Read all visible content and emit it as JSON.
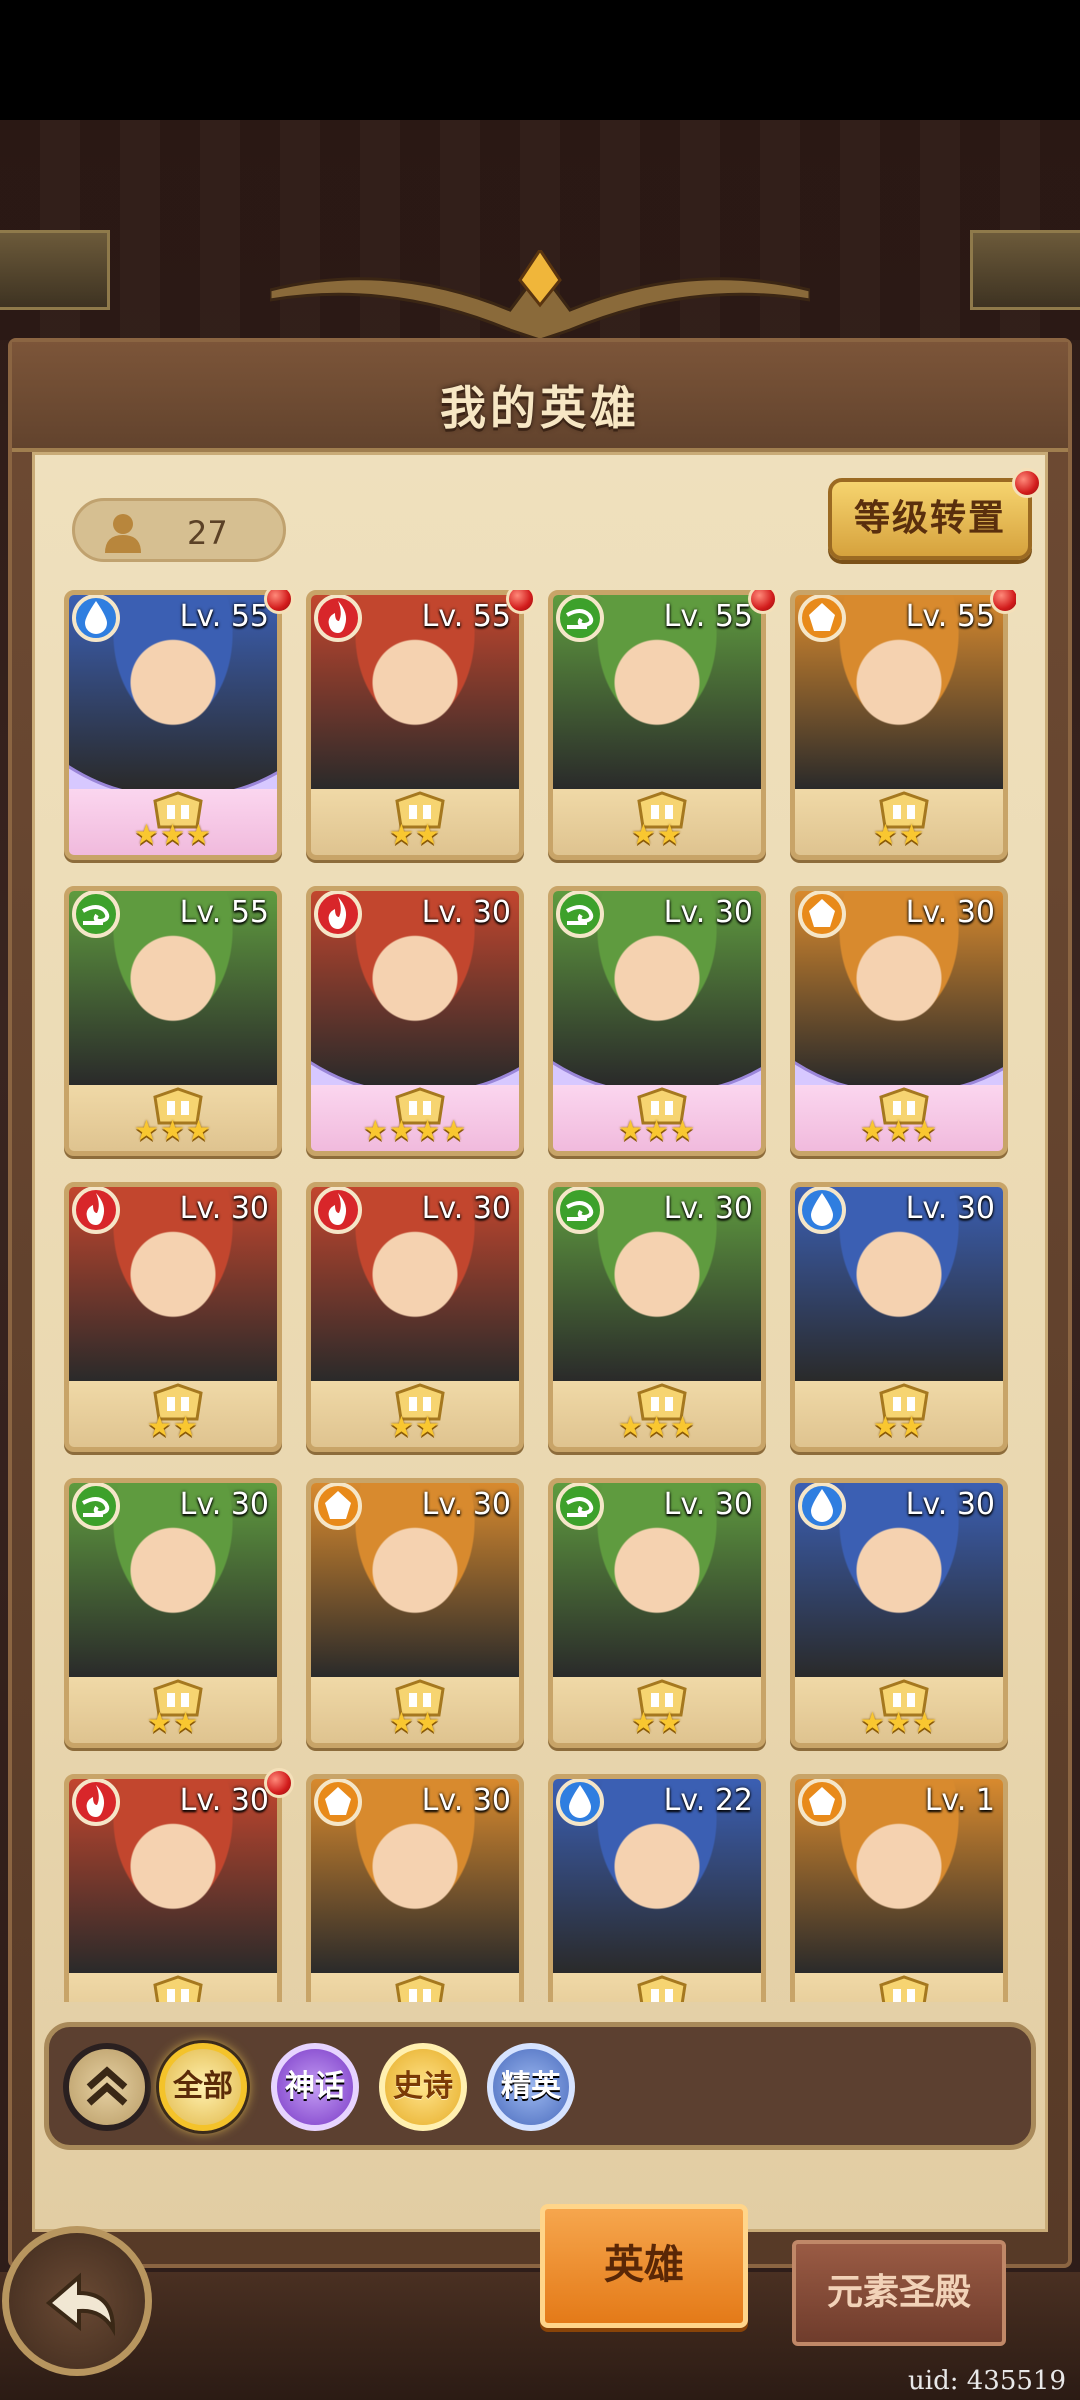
{
  "header": {
    "title": "我的英雄"
  },
  "hero_count": "27",
  "buttons": {
    "level_reset": "等级转置"
  },
  "heroes": [
    {
      "level": "Lv. 55",
      "stars": "★★★",
      "element": "water",
      "rarity": "legend",
      "notify": true
    },
    {
      "level": "Lv. 55",
      "stars": "★★",
      "element": "fire",
      "rarity": "epic",
      "notify": true
    },
    {
      "level": "Lv. 55",
      "stars": "★★",
      "element": "wind",
      "rarity": "epic",
      "notify": true
    },
    {
      "level": "Lv. 55",
      "stars": "★★",
      "element": "earth",
      "rarity": "epic",
      "notify": true
    },
    {
      "level": "Lv. 55",
      "stars": "★★★",
      "element": "wind",
      "rarity": "elite",
      "notify": false
    },
    {
      "level": "Lv. 30",
      "stars": "★★★★",
      "element": "fire",
      "rarity": "legend",
      "notify": false
    },
    {
      "level": "Lv. 30",
      "stars": "★★★",
      "element": "wind",
      "rarity": "legend",
      "notify": false
    },
    {
      "level": "Lv. 30",
      "stars": "★★★",
      "element": "earth",
      "rarity": "legend",
      "notify": false
    },
    {
      "level": "Lv. 30",
      "stars": "★★",
      "element": "fire",
      "rarity": "epic",
      "notify": false
    },
    {
      "level": "Lv. 30",
      "stars": "★★",
      "element": "fire",
      "rarity": "epic",
      "notify": false
    },
    {
      "level": "Lv. 30",
      "stars": "★★★",
      "element": "wind",
      "rarity": "epic",
      "notify": false
    },
    {
      "level": "Lv. 30",
      "stars": "★★",
      "element": "water",
      "rarity": "epic",
      "notify": false
    },
    {
      "level": "Lv. 30",
      "stars": "★★",
      "element": "wind",
      "rarity": "epic",
      "notify": false
    },
    {
      "level": "Lv. 30",
      "stars": "★★",
      "element": "earth",
      "rarity": "epic",
      "notify": false
    },
    {
      "level": "Lv. 30",
      "stars": "★★",
      "element": "wind",
      "rarity": "epic",
      "notify": false
    },
    {
      "level": "Lv. 30",
      "stars": "★★★",
      "element": "water",
      "rarity": "epic",
      "notify": false
    },
    {
      "level": "Lv. 30",
      "stars": "",
      "element": "fire",
      "rarity": "elite",
      "notify": true
    },
    {
      "level": "Lv. 30",
      "stars": "",
      "element": "earth",
      "rarity": "elite",
      "notify": false
    },
    {
      "level": "Lv. 22",
      "stars": "",
      "element": "water",
      "rarity": "epic",
      "notify": false
    },
    {
      "level": "Lv. 1",
      "stars": "",
      "element": "earth",
      "rarity": "epic",
      "notify": false
    }
  ],
  "filters": {
    "all": "全部",
    "myth": "神话",
    "epic": "史诗",
    "elite": "精英"
  },
  "tabs": {
    "hero": "英雄",
    "temple": "元素圣殿"
  },
  "uid": "uid: 435519",
  "colors": {
    "water": "#2f7ee0",
    "fire": "#d8262a",
    "wind": "#3da12b",
    "earth": "#e88a1a",
    "portrait_water": "#3b5fb3",
    "portrait_fire": "#c2462e",
    "portrait_wind": "#5f9b3f",
    "portrait_earth": "#d88a2e"
  }
}
